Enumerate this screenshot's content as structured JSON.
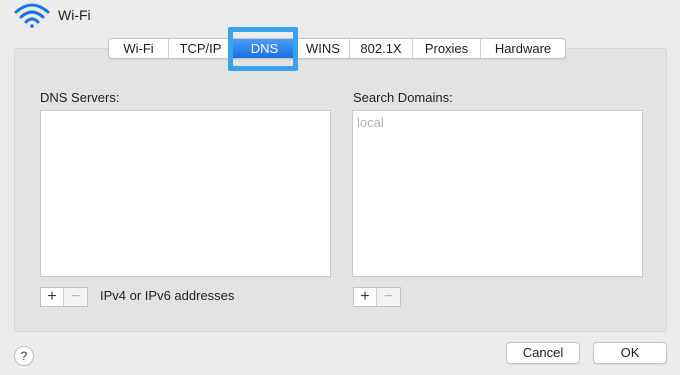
{
  "header": {
    "title": "Wi-Fi",
    "icon": "wifi-icon",
    "icon_color": "#1a73e8"
  },
  "tabs": [
    {
      "label": "Wi-Fi"
    },
    {
      "label": "TCP/IP"
    },
    {
      "label": "DNS",
      "active": true
    },
    {
      "label": "WINS"
    },
    {
      "label": "802.1X"
    },
    {
      "label": "Proxies"
    },
    {
      "label": "Hardware"
    }
  ],
  "dns_servers": {
    "label": "DNS Servers:",
    "entries": [],
    "add_label": "+",
    "remove_label": "−",
    "hint": "IPv4 or IPv6 addresses"
  },
  "search_domains": {
    "label": "Search Domains:",
    "placeholder": "local",
    "entries": [],
    "add_label": "+",
    "remove_label": "−"
  },
  "footer": {
    "help_label": "?",
    "cancel_label": "Cancel",
    "ok_label": "OK"
  },
  "colors": {
    "active_tab": "#1a6fe3",
    "highlight_border": "#3aa1ee"
  }
}
